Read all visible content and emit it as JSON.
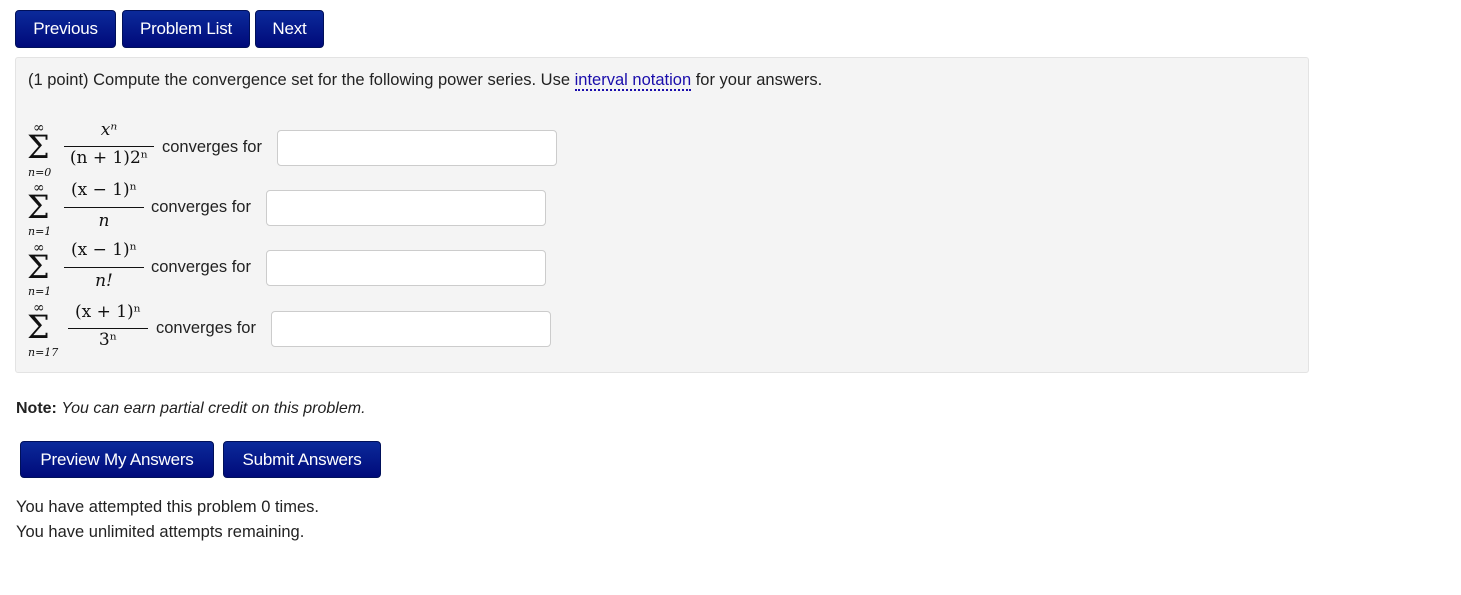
{
  "nav": {
    "previous": "Previous",
    "problem_list": "Problem List",
    "next": "Next"
  },
  "problem": {
    "intro_prefix": "(1 point) Compute the convergence set for the following power series. Use ",
    "intro_link": "interval notation",
    "intro_suffix": " for your answers.",
    "series": [
      {
        "upper": "∞",
        "lower": "n=0",
        "numerator": "xⁿ",
        "denominator": "(n + 1)2ⁿ",
        "label": "converges for",
        "answer": ""
      },
      {
        "upper": "∞",
        "lower": "n=1",
        "numerator": "(x − 1)ⁿ",
        "denominator": "n",
        "label": "converges for",
        "answer": ""
      },
      {
        "upper": "∞",
        "lower": "n=1",
        "numerator": "(x − 1)ⁿ",
        "denominator": "n!",
        "label": "converges for",
        "answer": ""
      },
      {
        "upper": "∞",
        "lower": "n=17",
        "numerator": "(x + 1)ⁿ",
        "denominator": "3ⁿ",
        "label": "converges for",
        "answer": ""
      }
    ]
  },
  "note": {
    "label": "Note:",
    "text": "You can earn partial credit on this problem."
  },
  "actions": {
    "preview": "Preview My Answers",
    "submit": "Submit Answers"
  },
  "status": {
    "attempts": "You have attempted this problem 0 times.",
    "remaining": "You have unlimited attempts remaining."
  }
}
